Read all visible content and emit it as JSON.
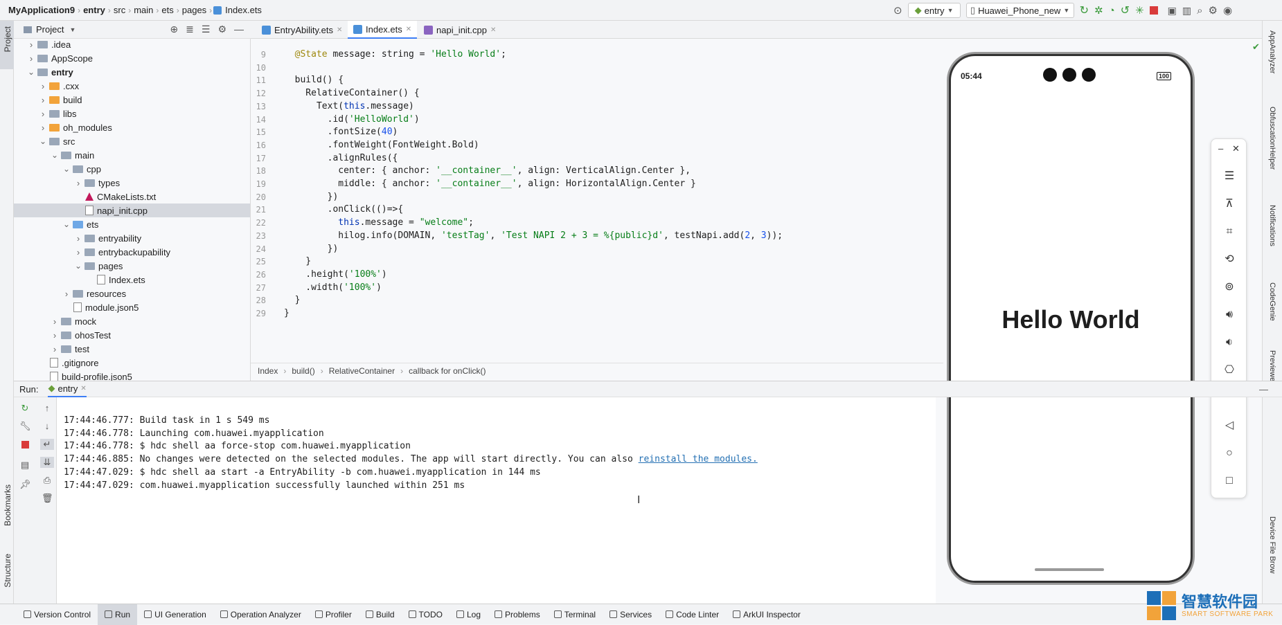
{
  "titlebar": {
    "breadcrumbs": [
      "MyApplication9",
      "entry",
      "src",
      "main",
      "ets",
      "pages",
      "Index.ets"
    ],
    "module_select": "entry",
    "device_select": "Huawei_Phone_new"
  },
  "left_strip": {
    "project_label": "Project",
    "bookmarks_label": "Bookmarks",
    "structure_label": "Structure"
  },
  "project_panel": {
    "title": "Project",
    "tree": [
      {
        "label": ".idea",
        "depth": 1,
        "expanded": false,
        "type": "folder"
      },
      {
        "label": "AppScope",
        "depth": 1,
        "expanded": false,
        "type": "folder"
      },
      {
        "label": "entry",
        "depth": 1,
        "expanded": true,
        "type": "folder",
        "bold": true
      },
      {
        "label": ".cxx",
        "depth": 2,
        "expanded": false,
        "type": "folder-orange"
      },
      {
        "label": "build",
        "depth": 2,
        "expanded": false,
        "type": "folder-orange"
      },
      {
        "label": "libs",
        "depth": 2,
        "expanded": false,
        "type": "folder"
      },
      {
        "label": "oh_modules",
        "depth": 2,
        "expanded": false,
        "type": "folder-orange"
      },
      {
        "label": "src",
        "depth": 2,
        "expanded": true,
        "type": "folder"
      },
      {
        "label": "main",
        "depth": 3,
        "expanded": true,
        "type": "folder"
      },
      {
        "label": "cpp",
        "depth": 4,
        "expanded": true,
        "type": "folder"
      },
      {
        "label": "types",
        "depth": 5,
        "expanded": false,
        "type": "folder"
      },
      {
        "label": "CMakeLists.txt",
        "depth": 5,
        "type": "cmake"
      },
      {
        "label": "napi_init.cpp",
        "depth": 5,
        "type": "file",
        "selected": true
      },
      {
        "label": "ets",
        "depth": 4,
        "expanded": true,
        "type": "folder-blue"
      },
      {
        "label": "entryability",
        "depth": 5,
        "expanded": false,
        "type": "folder"
      },
      {
        "label": "entrybackupability",
        "depth": 5,
        "expanded": false,
        "type": "folder"
      },
      {
        "label": "pages",
        "depth": 5,
        "expanded": true,
        "type": "folder"
      },
      {
        "label": "Index.ets",
        "depth": 6,
        "type": "file"
      },
      {
        "label": "resources",
        "depth": 4,
        "expanded": false,
        "type": "folder"
      },
      {
        "label": "module.json5",
        "depth": 4,
        "type": "file"
      },
      {
        "label": "mock",
        "depth": 3,
        "expanded": false,
        "type": "folder"
      },
      {
        "label": "ohosTest",
        "depth": 3,
        "expanded": false,
        "type": "folder"
      },
      {
        "label": "test",
        "depth": 3,
        "expanded": false,
        "type": "folder"
      },
      {
        "label": ".gitignore",
        "depth": 2,
        "type": "file"
      },
      {
        "label": "build-profile.json5",
        "depth": 2,
        "type": "file"
      }
    ]
  },
  "editor_tabs": [
    {
      "label": "EntryAbility.ets",
      "active": false
    },
    {
      "label": "Index.ets",
      "active": true
    },
    {
      "label": "napi_init.cpp",
      "active": false
    }
  ],
  "code": {
    "line_numbers": [
      "9",
      "10",
      "11",
      "12",
      "13",
      "14",
      "15",
      "16",
      "17",
      "18",
      "19",
      "20",
      "21",
      "22",
      "23",
      "24",
      "25",
      "26",
      "27",
      "28",
      "29"
    ],
    "lines": [
      "  @State message: string = 'Hello World';",
      "",
      "  build() {",
      "    RelativeContainer() {",
      "      Text(this.message)",
      "        .id('HelloWorld')",
      "        .fontSize(40)",
      "        .fontWeight(FontWeight.Bold)",
      "        .alignRules({",
      "          center: { anchor: '__container__', align: VerticalAlign.Center },",
      "          middle: { anchor: '__container__', align: HorizontalAlign.Center }",
      "        })",
      "        .onClick(()=>{",
      "          this.message = \"welcome\";",
      "          hilog.info(DOMAIN, 'testTag', 'Test NAPI 2 + 3 = %{public}d', testNapi.add(2, 3));",
      "        })",
      "    }",
      "    .height('100%')",
      "    .width('100%')",
      "  }",
      "}"
    ]
  },
  "breadcrumb_bar": [
    "Index",
    "build()",
    "RelativeContainer",
    "callback for onClick()"
  ],
  "phone": {
    "time": "05:44",
    "battery": "100",
    "content_text": "Hello World"
  },
  "run_panel": {
    "label": "Run:",
    "tab": "entry",
    "console": [
      {
        "text": "17:44:46.777: Build task in 1 s 549 ms"
      },
      {
        "text": "17:44:46.778: Launching com.huawei.myapplication"
      },
      {
        "text": "17:44:46.778: $ hdc shell aa force-stop com.huawei.myapplication"
      },
      {
        "text": "17:44:46.885: No changes were detected on the selected modules. The app will start directly. You can also ",
        "link": "reinstall the modules."
      },
      {
        "text": "17:44:47.029: $ hdc shell aa start -a EntryAbility -b com.huawei.myapplication in 144 ms"
      },
      {
        "text": "17:44:47.029: com.huawei.myapplication successfully launched within 251 ms"
      }
    ]
  },
  "statusbar": {
    "items": [
      "Version Control",
      "Run",
      "UI Generation",
      "Operation Analyzer",
      "Profiler",
      "Build",
      "TODO",
      "Log",
      "Problems",
      "Terminal",
      "Services",
      "Code Linter",
      "ArkUI Inspector"
    ],
    "active": "Run"
  },
  "right_strip": [
    "AppAnalyzer",
    "ObfuscationHelper",
    "Notifications",
    "CodeGenie",
    "Previewer",
    "Device File Brow"
  ],
  "watermark": {
    "cn": "智慧软件园",
    "en": "SMART SOFTWARE PARK"
  },
  "colors": {
    "accent": "#3d7ef5",
    "keyword": "#0033b3",
    "string": "#067d17",
    "link": "#2470b3"
  }
}
